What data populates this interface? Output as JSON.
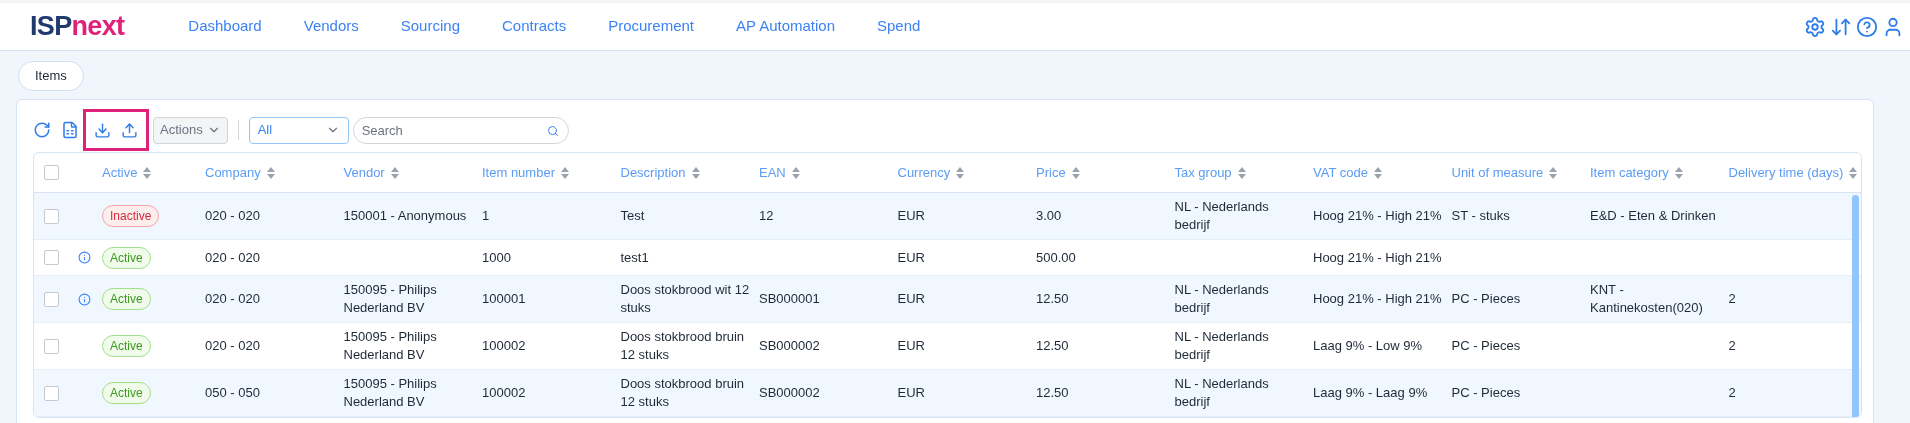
{
  "logo": {
    "part_1": "ISP",
    "part_2": "next"
  },
  "nav": [
    {
      "label": "Dashboard"
    },
    {
      "label": "Vendors"
    },
    {
      "label": "Sourcing"
    },
    {
      "label": "Contracts"
    },
    {
      "label": "Procurement"
    },
    {
      "label": "AP Automation"
    },
    {
      "label": "Spend"
    }
  ],
  "breadcrumb_tab": "Items",
  "toolbar": {
    "actions_label": "Actions",
    "filter_value": "All",
    "search_placeholder": "Search"
  },
  "table": {
    "select_all_checked": false,
    "columns": [
      "Active",
      "Company",
      "Vendor",
      "Item number",
      "Description",
      "EAN",
      "Currency",
      "Price",
      "Tax group",
      "VAT code",
      "Unit of measure",
      "Item category",
      "Delivery time (days)"
    ],
    "rows": [
      {
        "checked": false,
        "info": false,
        "cells": [
          {
            "label": "Inactive",
            "kind": "inactive"
          },
          "020 - 020",
          "150001 - Anonymous",
          "1",
          "Test",
          "12",
          "EUR",
          "3.00",
          "NL - Nederlands bedrijf",
          "Hoog 21% - High 21%",
          "ST - stuks",
          "E&D - Eten & Drinken",
          ""
        ]
      },
      {
        "checked": false,
        "info": true,
        "cells": [
          {
            "label": "Active",
            "kind": "active"
          },
          "020 - 020",
          "",
          "1000",
          "test1",
          "",
          "EUR",
          "500.00",
          "",
          "Hoog 21% - High 21%",
          "",
          "",
          ""
        ]
      },
      {
        "checked": false,
        "info": true,
        "cells": [
          {
            "label": "Active",
            "kind": "active"
          },
          "020 - 020",
          "150095 - Philips Nederland BV",
          "100001",
          "Doos stokbrood wit 12 stuks",
          "SB000001",
          "EUR",
          "12.50",
          "NL - Nederlands bedrijf",
          "Hoog 21% - High 21%",
          "PC - Pieces",
          "KNT - Kantinekosten(020)",
          "2"
        ]
      },
      {
        "checked": false,
        "info": false,
        "cells": [
          {
            "label": "Active",
            "kind": "active"
          },
          "020 - 020",
          "150095 - Philips Nederland BV",
          "100002",
          "Doos stokbrood bruin 12 stuks",
          "SB000002",
          "EUR",
          "12.50",
          "NL - Nederlands bedrijf",
          "Laag 9% - Low 9%",
          "PC - Pieces",
          "",
          "2"
        ]
      },
      {
        "checked": false,
        "info": false,
        "cells": [
          {
            "label": "Active",
            "kind": "active"
          },
          "050 - 050",
          "150095 - Philips Nederland BV",
          "100002",
          "Doos stokbrood bruin 12 stuks",
          "SB000002",
          "EUR",
          "12.50",
          "NL - Nederlands bedrijf",
          "Laag 9% - Laag 9%",
          "PC - Pieces",
          "",
          "2"
        ]
      }
    ]
  }
}
